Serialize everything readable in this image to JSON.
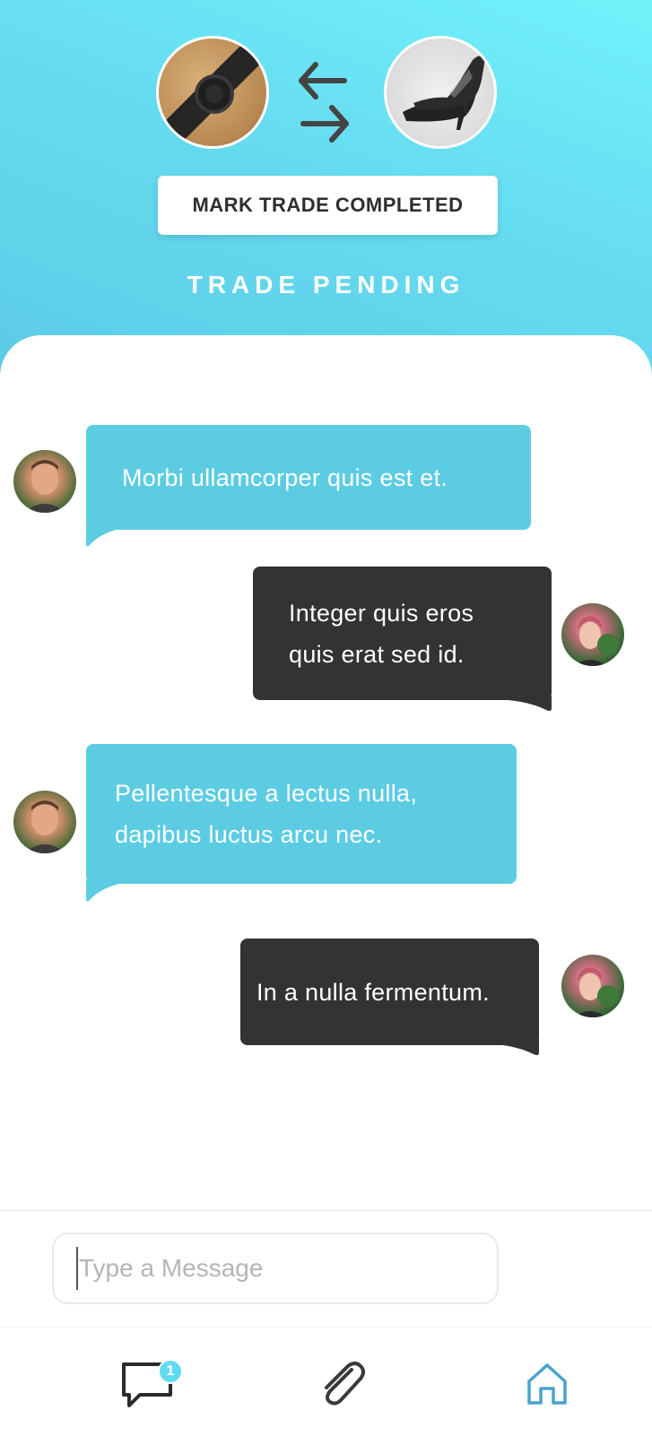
{
  "header": {
    "mark_button_label": "MARK TRADE COMPLETED",
    "status_label": "TRADE PENDING",
    "accent_color": "#5ccce3"
  },
  "items": {
    "offered": {
      "icon": "watch-photo"
    },
    "requested": {
      "icon": "high-heel-shoes-photo"
    }
  },
  "messages": [
    {
      "side": "incoming",
      "avatar": "man-avatar",
      "text": "Morbi ullamcorper quis est et."
    },
    {
      "side": "outgoing",
      "avatar": "woman-avatar",
      "line1": "Integer quis eros",
      "line2": "quis erat sed id."
    },
    {
      "side": "incoming",
      "avatar": "man-avatar",
      "line1": "Pellentesque a lectus nulla,",
      "line2": "dapibus luctus arcu nec."
    },
    {
      "side": "outgoing",
      "avatar": "woman-avatar",
      "text": "In a nulla fermentum."
    }
  ],
  "composer": {
    "placeholder": "Type a Message",
    "value": ""
  },
  "tabs": {
    "chat": {
      "icon": "chat-bubble-icon",
      "badge": "1"
    },
    "attach": {
      "icon": "paperclip-icon"
    },
    "home": {
      "icon": "home-icon",
      "color": "#4aa3cf"
    }
  }
}
